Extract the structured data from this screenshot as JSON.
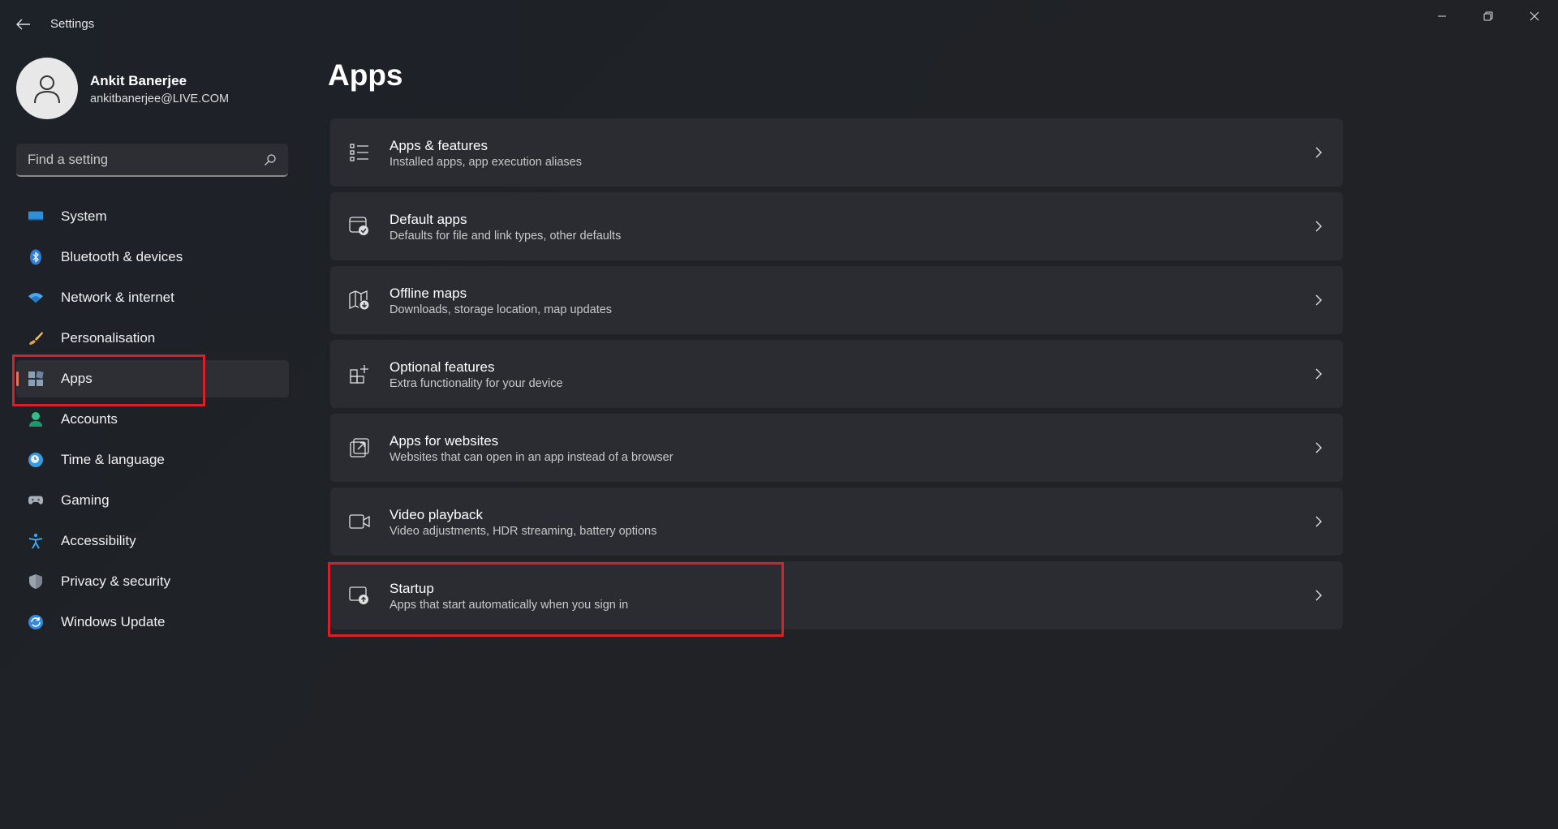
{
  "titlebar": {
    "title": "Settings",
    "back_icon": "back-arrow-icon",
    "minimize_icon": "minimize-icon",
    "maximize_icon": "restore-icon",
    "close_icon": "close-icon"
  },
  "profile": {
    "name": "Ankit Banerjee",
    "email": "ankitbanerjee@LIVE.COM",
    "avatar_icon": "user-avatar-icon"
  },
  "search": {
    "placeholder": "Find a setting",
    "icon": "search-icon"
  },
  "sidebar": {
    "selected": "Apps",
    "items": [
      {
        "label": "System",
        "icon": "system-monitor-icon"
      },
      {
        "label": "Bluetooth & devices",
        "icon": "bluetooth-icon"
      },
      {
        "label": "Network & internet",
        "icon": "wifi-icon"
      },
      {
        "label": "Personalisation",
        "icon": "brush-icon"
      },
      {
        "label": "Apps",
        "icon": "apps-icon"
      },
      {
        "label": "Accounts",
        "icon": "accounts-icon"
      },
      {
        "label": "Time & language",
        "icon": "clock-globe-icon"
      },
      {
        "label": "Gaming",
        "icon": "gamepad-icon"
      },
      {
        "label": "Accessibility",
        "icon": "accessibility-icon"
      },
      {
        "label": "Privacy & security",
        "icon": "shield-icon"
      },
      {
        "label": "Windows Update",
        "icon": "update-icon"
      }
    ]
  },
  "main": {
    "title": "Apps",
    "cards": [
      {
        "title": "Apps & features",
        "subtitle": "Installed apps, app execution aliases",
        "icon": "list-icon"
      },
      {
        "title": "Default apps",
        "subtitle": "Defaults for file and link types, other defaults",
        "icon": "default-apps-icon"
      },
      {
        "title": "Offline maps",
        "subtitle": "Downloads, storage location, map updates",
        "icon": "map-download-icon"
      },
      {
        "title": "Optional features",
        "subtitle": "Extra functionality for your device",
        "icon": "add-grid-icon"
      },
      {
        "title": "Apps for websites",
        "subtitle": "Websites that can open in an app instead of a browser",
        "icon": "open-external-icon"
      },
      {
        "title": "Video playback",
        "subtitle": "Video adjustments, HDR streaming, battery options",
        "icon": "video-camera-icon"
      },
      {
        "title": "Startup",
        "subtitle": "Apps that start automatically when you sign in",
        "icon": "startup-icon"
      }
    ]
  },
  "colors": {
    "background": "#1f2226",
    "card": "#2a2c31",
    "accent_indicator": "#e8715f",
    "annotation_red": "#d9202a"
  }
}
